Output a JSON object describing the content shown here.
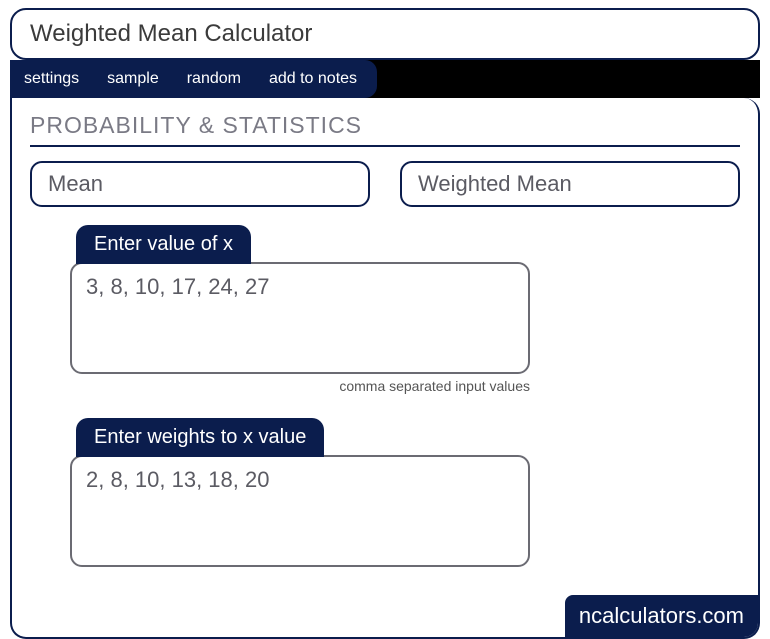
{
  "title": "Weighted Mean Calculator",
  "toolbar": {
    "items": [
      "settings",
      "sample",
      "random",
      "add to notes"
    ]
  },
  "section_title": "PROBABILITY & STATISTICS",
  "subtabs": {
    "mean": "Mean",
    "weighted_mean": "Weighted Mean"
  },
  "fields": {
    "x": {
      "label": "Enter value of x",
      "value": "3, 8, 10, 17, 24, 27",
      "hint": "comma separated input values"
    },
    "weights": {
      "label": "Enter weights to x value",
      "value": "2, 8, 10, 13, 18, 20"
    }
  },
  "watermark": "ncalculators.com"
}
